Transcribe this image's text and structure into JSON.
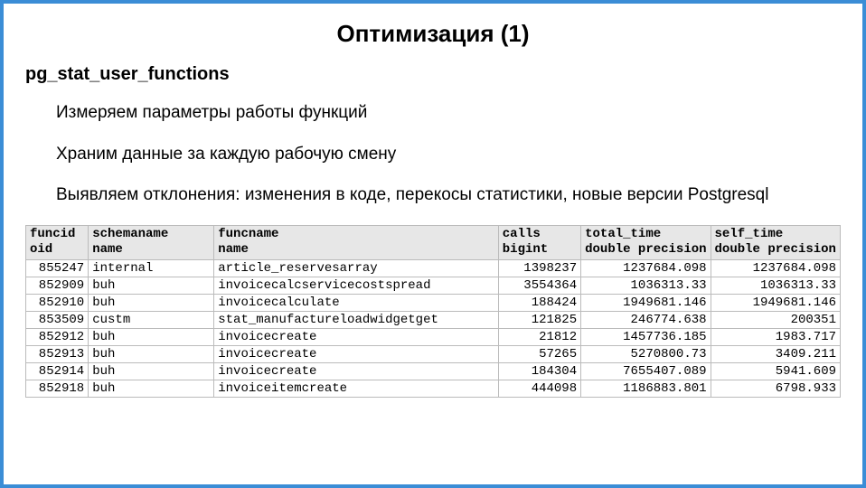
{
  "title_bold": "Оптимизация",
  "title_num": "(1)",
  "subtitle": "pg_stat_user_functions",
  "points": [
    "Измеряем параметры работы функций",
    "Храним данные за каждую рабочую смену",
    "Выявляем отклонения: изменения в коде, перекосы статистики, новые версии Postgresql"
  ],
  "columns": [
    {
      "h1": "funcid",
      "h2": "oid"
    },
    {
      "h1": "schemaname",
      "h2": "name"
    },
    {
      "h1": "funcname",
      "h2": "name"
    },
    {
      "h1": "calls",
      "h2": "bigint"
    },
    {
      "h1": "total_time",
      "h2": "double precision"
    },
    {
      "h1": "self_time",
      "h2": "double precision"
    }
  ],
  "rows": [
    {
      "funcid": "855247",
      "schemaname": "internal",
      "funcname": "article_reservesarray",
      "calls": "1398237",
      "total_time": "1237684.098",
      "self_time": "1237684.098"
    },
    {
      "funcid": "852909",
      "schemaname": "buh",
      "funcname": "invoicecalcservicecostspread",
      "calls": "3554364",
      "total_time": "1036313.33",
      "self_time": "1036313.33"
    },
    {
      "funcid": "852910",
      "schemaname": "buh",
      "funcname": "invoicecalculate",
      "calls": "188424",
      "total_time": "1949681.146",
      "self_time": "1949681.146"
    },
    {
      "funcid": "853509",
      "schemaname": "custm",
      "funcname": "stat_manufactureloadwidgetget",
      "calls": "121825",
      "total_time": "246774.638",
      "self_time": "200351"
    },
    {
      "funcid": "852912",
      "schemaname": "buh",
      "funcname": "invoicecreate",
      "calls": "21812",
      "total_time": "1457736.185",
      "self_time": "1983.717"
    },
    {
      "funcid": "852913",
      "schemaname": "buh",
      "funcname": "invoicecreate",
      "calls": "57265",
      "total_time": "5270800.73",
      "self_time": "3409.211"
    },
    {
      "funcid": "852914",
      "schemaname": "buh",
      "funcname": "invoicecreate",
      "calls": "184304",
      "total_time": "7655407.089",
      "self_time": "5941.609"
    },
    {
      "funcid": "852918",
      "schemaname": "buh",
      "funcname": "invoiceitemcreate",
      "calls": "444098",
      "total_time": "1186883.801",
      "self_time": "6798.933"
    }
  ]
}
